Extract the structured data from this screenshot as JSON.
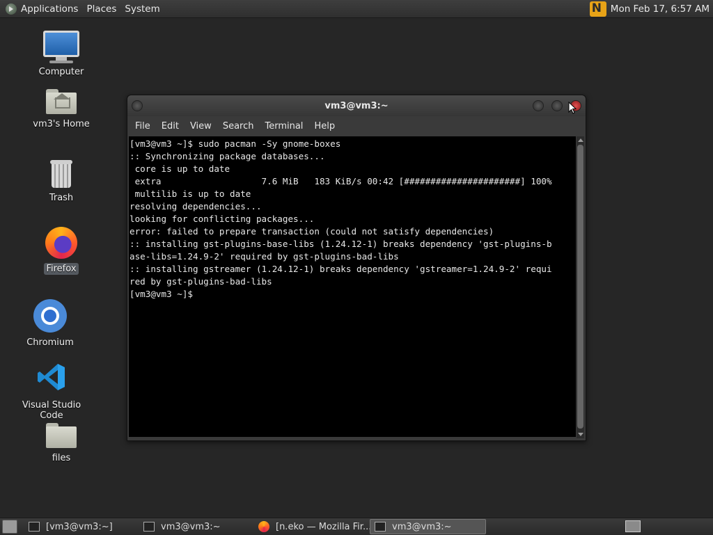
{
  "top_panel": {
    "menus": [
      "Applications",
      "Places",
      "System"
    ],
    "clock": "Mon Feb 17,  6:57 AM",
    "icons": {
      "apps": "gnome-foot-icon",
      "tray": "neko-icon"
    }
  },
  "desktop_icons": [
    {
      "label": "Computer",
      "icon": "computer-icon"
    },
    {
      "label": "vm3's Home",
      "icon": "home-folder-icon"
    },
    {
      "label": "Trash",
      "icon": "trash-icon"
    },
    {
      "label": "Firefox",
      "icon": "firefox-icon",
      "selected": true
    },
    {
      "label": "Chromium",
      "icon": "chromium-icon"
    },
    {
      "label": "Visual Studio Code",
      "icon": "vscode-icon"
    },
    {
      "label": "files",
      "icon": "folder-icon"
    }
  ],
  "terminal": {
    "title": "vm3@vm3:~",
    "menu": [
      "File",
      "Edit",
      "View",
      "Search",
      "Terminal",
      "Help"
    ],
    "lines": [
      "[vm3@vm3 ~]$ sudo pacman -Sy gnome-boxes",
      ":: Synchronizing package databases...",
      " core is up to date",
      " extra                   7.6 MiB   183 KiB/s 00:42 [######################] 100%",
      " multilib is up to date",
      "resolving dependencies...",
      "looking for conflicting packages...",
      "error: failed to prepare transaction (could not satisfy dependencies)",
      ":: installing gst-plugins-base-libs (1.24.12-1) breaks dependency 'gst-plugins-b",
      "ase-libs=1.24.9-2' required by gst-plugins-bad-libs",
      ":: installing gstreamer (1.24.12-1) breaks dependency 'gstreamer=1.24.9-2' requi",
      "red by gst-plugins-bad-libs",
      "[vm3@vm3 ~]$"
    ]
  },
  "taskbar": {
    "tasks": [
      {
        "label": "[vm3@vm3:~]",
        "icon": "terminal-icon",
        "active": false
      },
      {
        "label": "vm3@vm3:~",
        "icon": "terminal-icon",
        "active": false
      },
      {
        "label": "[n.eko — Mozilla Fir...",
        "icon": "firefox-icon",
        "active": false
      },
      {
        "label": "vm3@vm3:~",
        "icon": "terminal-icon",
        "active": true
      }
    ]
  },
  "colors": {
    "desktop_bg": "#262626",
    "terminal_bg": "#000000",
    "terminal_fg": "#e8e8e8",
    "close_button": "#d03a3a"
  }
}
